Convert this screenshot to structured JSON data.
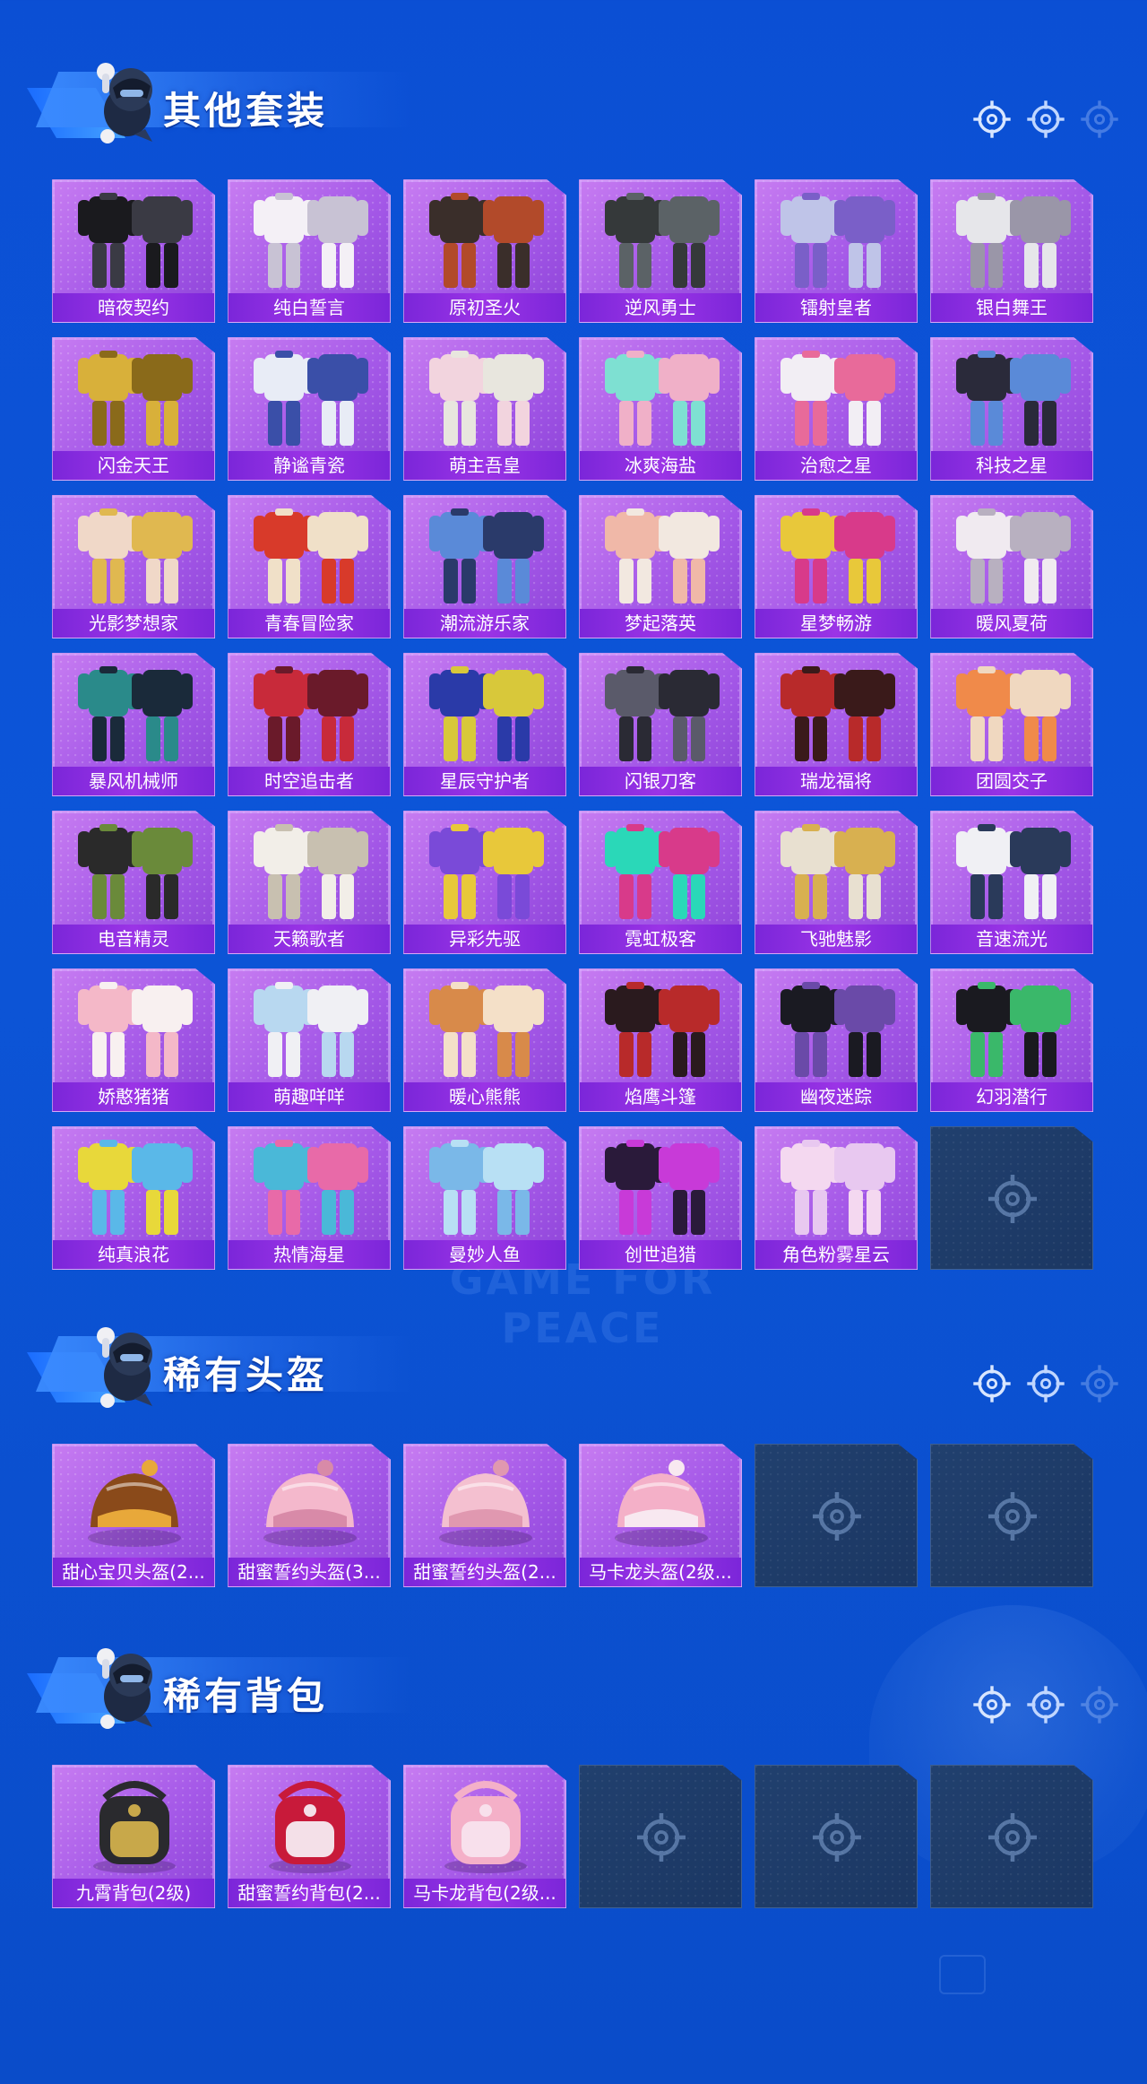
{
  "colors": {
    "background": "#0b4fd4",
    "card_purple": "#a559e8",
    "card_label": "#7b26d9",
    "empty_slot": "#1e3b68"
  },
  "watermark": "GAME FOR PEACE",
  "sections": [
    {
      "title": "其他套装",
      "items": [
        {
          "label": "暗夜契约",
          "palette": [
            "#1a1a1e",
            "#3a3a44"
          ]
        },
        {
          "label": "纯白誓言",
          "palette": [
            "#f4f0f6",
            "#c8c2d4"
          ]
        },
        {
          "label": "原初圣火",
          "palette": [
            "#3a2e2a",
            "#b24a2a"
          ]
        },
        {
          "label": "逆风勇士",
          "palette": [
            "#35393a",
            "#5b6266"
          ]
        },
        {
          "label": "镭射皇者",
          "palette": [
            "#bfc4e8",
            "#7a5fc8"
          ]
        },
        {
          "label": "银白舞王",
          "palette": [
            "#e6e6ea",
            "#9a96a8"
          ]
        },
        {
          "label": "闪金天王",
          "palette": [
            "#d8b03a",
            "#8a6a1a"
          ]
        },
        {
          "label": "静谧青瓷",
          "palette": [
            "#e8ecf6",
            "#3a4fa8"
          ]
        },
        {
          "label": "萌主吾皇",
          "palette": [
            "#f2d4de",
            "#e8e6de"
          ]
        },
        {
          "label": "冰爽海盐",
          "palette": [
            "#7ee0d2",
            "#f0b0c8"
          ]
        },
        {
          "label": "治愈之星",
          "palette": [
            "#f2eef4",
            "#e86a9a"
          ]
        },
        {
          "label": "科技之星",
          "palette": [
            "#2a2a3a",
            "#5a8ad8"
          ]
        },
        {
          "label": "光影梦想家",
          "palette": [
            "#f0d8c8",
            "#e0b850"
          ]
        },
        {
          "label": "青春冒险家",
          "palette": [
            "#d83a2a",
            "#f0e0c8"
          ]
        },
        {
          "label": "潮流游乐家",
          "palette": [
            "#5a8ad8",
            "#2a3a6a"
          ]
        },
        {
          "label": "梦起落英",
          "palette": [
            "#f0b8a8",
            "#f2e8e0"
          ]
        },
        {
          "label": "星梦畅游",
          "palette": [
            "#e8c83a",
            "#d83a8a"
          ]
        },
        {
          "label": "暖风夏荷",
          "palette": [
            "#f0eaf0",
            "#b8b0c0"
          ]
        },
        {
          "label": "暴风机械师",
          "palette": [
            "#2a8a8a",
            "#1a2a3a"
          ]
        },
        {
          "label": "时空追击者",
          "palette": [
            "#c82a3a",
            "#6a1a2a"
          ]
        },
        {
          "label": "星辰守护者",
          "palette": [
            "#2a3aa8",
            "#d8c83a"
          ]
        },
        {
          "label": "闪银刀客",
          "palette": [
            "#5a5a6a",
            "#2a2a34"
          ]
        },
        {
          "label": "瑞龙福将",
          "palette": [
            "#b82a2a",
            "#3a1a1a"
          ]
        },
        {
          "label": "团圆交子",
          "palette": [
            "#f08a4a",
            "#f0d8c0"
          ]
        },
        {
          "label": "电音精灵",
          "palette": [
            "#2a2a2a",
            "#6a8a3a"
          ]
        },
        {
          "label": "天籁歌者",
          "palette": [
            "#f2eee8",
            "#c8c0b0"
          ]
        },
        {
          "label": "异彩先驱",
          "palette": [
            "#7a4ad8",
            "#e8c83a"
          ]
        },
        {
          "label": "霓虹极客",
          "palette": [
            "#2ad8b8",
            "#d83a8a"
          ]
        },
        {
          "label": "飞驰魅影",
          "palette": [
            "#e8e0d0",
            "#d8b050"
          ]
        },
        {
          "label": "音速流光",
          "palette": [
            "#f0f0f4",
            "#2a3a5a"
          ]
        },
        {
          "label": "娇憨猪猪",
          "palette": [
            "#f4b8c8",
            "#f8f0f0"
          ]
        },
        {
          "label": "萌趣咩咩",
          "palette": [
            "#b8d8f0",
            "#f0f0f4"
          ]
        },
        {
          "label": "暖心熊熊",
          "palette": [
            "#d88a4a",
            "#f4e0c8"
          ]
        },
        {
          "label": "焰鹰斗篷",
          "palette": [
            "#2a1a1e",
            "#b82a2a"
          ]
        },
        {
          "label": "幽夜迷踪",
          "palette": [
            "#1a1a22",
            "#6a4aa8"
          ]
        },
        {
          "label": "幻羽潜行",
          "palette": [
            "#1a1a20",
            "#3ab86a"
          ]
        },
        {
          "label": "纯真浪花",
          "palette": [
            "#e8d83a",
            "#5ab8e8"
          ]
        },
        {
          "label": "热情海星",
          "palette": [
            "#4ab8d8",
            "#e86aa8"
          ]
        },
        {
          "label": "曼妙人鱼",
          "palette": [
            "#7ab8e8",
            "#b8e0f4"
          ]
        },
        {
          "label": "创世追猎",
          "palette": [
            "#2a1a3a",
            "#c83ad8"
          ]
        },
        {
          "label": "角色粉雾星云",
          "palette": [
            "#f4d8f0",
            "#e8c8f0"
          ]
        },
        {
          "label": "",
          "empty": true
        }
      ]
    },
    {
      "title": "稀有头盔",
      "items": [
        {
          "label": "甜心宝贝头盔(2...",
          "palette": [
            "#8a4a1a",
            "#e8a83a"
          ],
          "kind": "helmet"
        },
        {
          "label": "甜蜜誓约头盔(3...",
          "palette": [
            "#f4b8cc",
            "#d88aa8"
          ],
          "kind": "helmet"
        },
        {
          "label": "甜蜜誓约头盔(2...",
          "palette": [
            "#f4c0d0",
            "#e098b0"
          ],
          "kind": "helmet"
        },
        {
          "label": "马卡龙头盔(2级...",
          "palette": [
            "#f4b0c8",
            "#f8e8f0"
          ],
          "kind": "helmet"
        },
        {
          "label": "",
          "empty": true
        },
        {
          "label": "",
          "empty": true
        }
      ]
    },
    {
      "title": "稀有背包",
      "items": [
        {
          "label": "九霄背包(2级)",
          "palette": [
            "#2a2a2e",
            "#c8a84a"
          ],
          "kind": "bag"
        },
        {
          "label": "甜蜜誓约背包(2...",
          "palette": [
            "#c81a3a",
            "#f4e0e8"
          ],
          "kind": "bag"
        },
        {
          "label": "马卡龙背包(2级...",
          "palette": [
            "#f4b0c8",
            "#f8e0ec"
          ],
          "kind": "bag"
        },
        {
          "label": "",
          "empty": true
        },
        {
          "label": "",
          "empty": true
        },
        {
          "label": "",
          "empty": true
        }
      ]
    }
  ]
}
